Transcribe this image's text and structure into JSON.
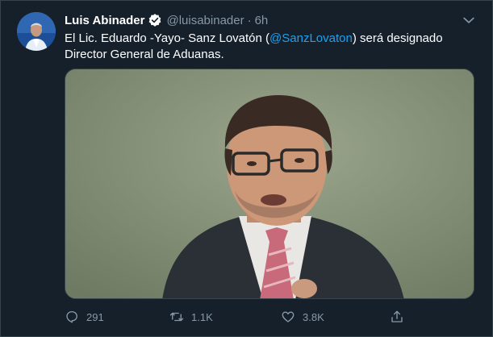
{
  "colors": {
    "background": "#15202b",
    "mention": "#1da1f2",
    "muted": "#8899a6",
    "border": "#38444d",
    "verified": "#ffffff"
  },
  "tweet": {
    "author_name": "Luis Abinader",
    "handle": "@luisabinader",
    "separator": "·",
    "time": "6h",
    "text_before": "El Lic. Eduardo -Yayo- Sanz Lovatón (",
    "mention": "@SanzLovaton",
    "text_after": ") será designado Director General de Aduanas.",
    "icons": {
      "verified": "verified-badge-icon",
      "menu": "chevron-down-icon"
    }
  },
  "actions": {
    "reply": {
      "icon": "reply-icon",
      "count": "291"
    },
    "retweet": {
      "icon": "retweet-icon",
      "count": "1.1K"
    },
    "like": {
      "icon": "heart-icon",
      "count": "3.8K"
    },
    "share": {
      "icon": "share-icon"
    }
  }
}
